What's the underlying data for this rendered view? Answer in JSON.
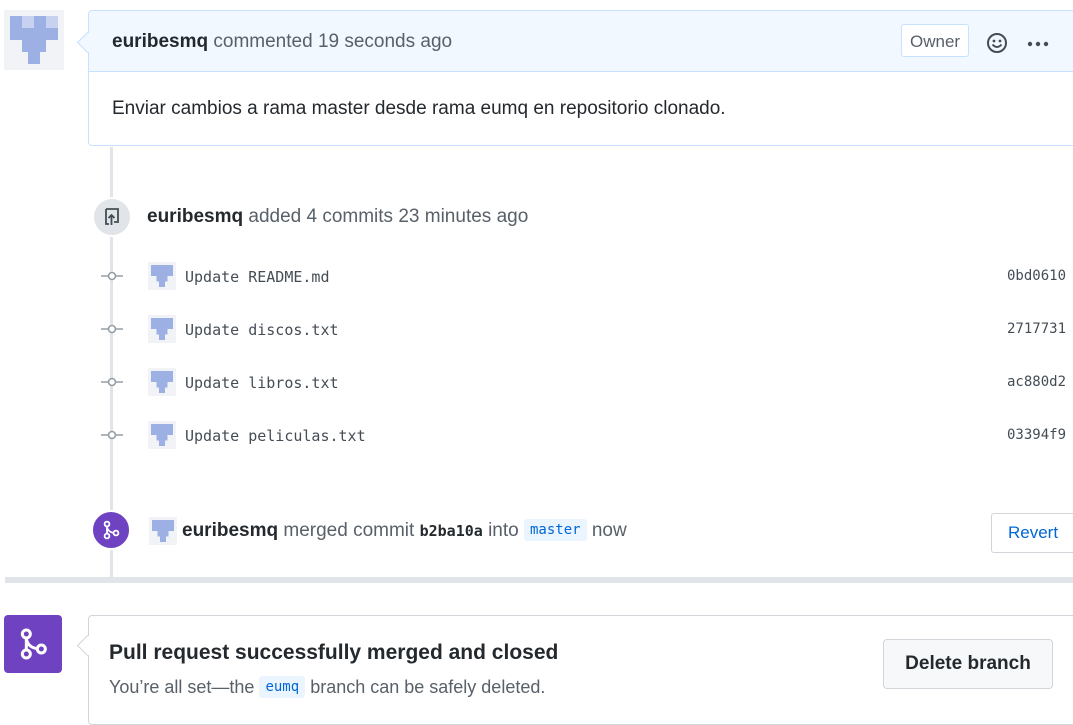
{
  "comment": {
    "author": "euribesmq",
    "action": "commented",
    "time": "19 seconds ago",
    "badge": "Owner",
    "body": "Enviar cambios a rama master desde rama eumq en repositorio clonado."
  },
  "commits_event": {
    "author": "euribesmq",
    "action": "added 4 commits",
    "time": "23 minutes ago",
    "commits": [
      {
        "message": "Update README.md",
        "sha": "0bd0610"
      },
      {
        "message": "Update discos.txt",
        "sha": "2717731"
      },
      {
        "message": "Update libros.txt",
        "sha": "ac880d2"
      },
      {
        "message": "Update peliculas.txt",
        "sha": "03394f9"
      }
    ]
  },
  "merge_event": {
    "author": "euribesmq",
    "action": "merged commit",
    "sha": "b2ba10a",
    "into": "into",
    "branch": "master",
    "time": "now",
    "revert_label": "Revert"
  },
  "merged_box": {
    "title": "Pull request successfully merged and closed",
    "sub_prefix": "You’re all set—the",
    "branch": "eumq",
    "sub_suffix": "branch can be safely deleted.",
    "delete_label": "Delete branch"
  },
  "icons": {
    "avatar": "identicon-avatar",
    "emoji": "smiley-icon",
    "more": "kebab-horizontal-icon",
    "commits": "repo-push-icon",
    "commit_node": "git-commit-icon",
    "merge": "git-merge-icon"
  },
  "colors": {
    "merged_purple": "#6f42c1",
    "link_blue": "#0366d6",
    "header_blue": "#f1f8ff",
    "identicon": "#9db0e3"
  }
}
